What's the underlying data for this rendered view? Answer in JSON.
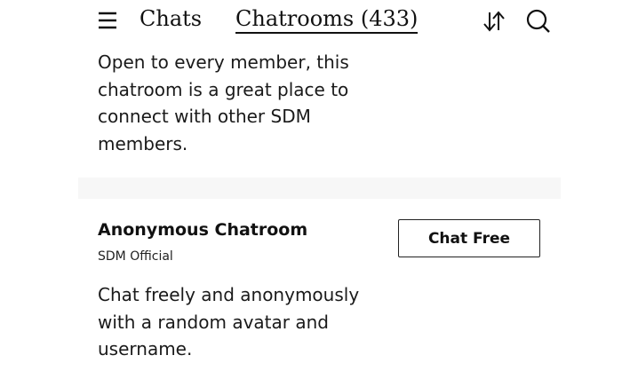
{
  "header": {
    "menu_icon": "hamburger-menu-icon",
    "tab_chats": "Chats",
    "tab_chatrooms": "Chatrooms (433)",
    "sort_icon": "sort-arrows-icon",
    "search_icon": "search-icon"
  },
  "chatrooms": [
    {
      "description": "Open to every member, this chatroom is a great place to connect with other SDM members."
    },
    {
      "title": "Anonymous Chatroom",
      "subtitle": "SDM Official",
      "button_label": "Chat Free",
      "description": "Chat freely and anonymously with a random avatar and username."
    }
  ]
}
